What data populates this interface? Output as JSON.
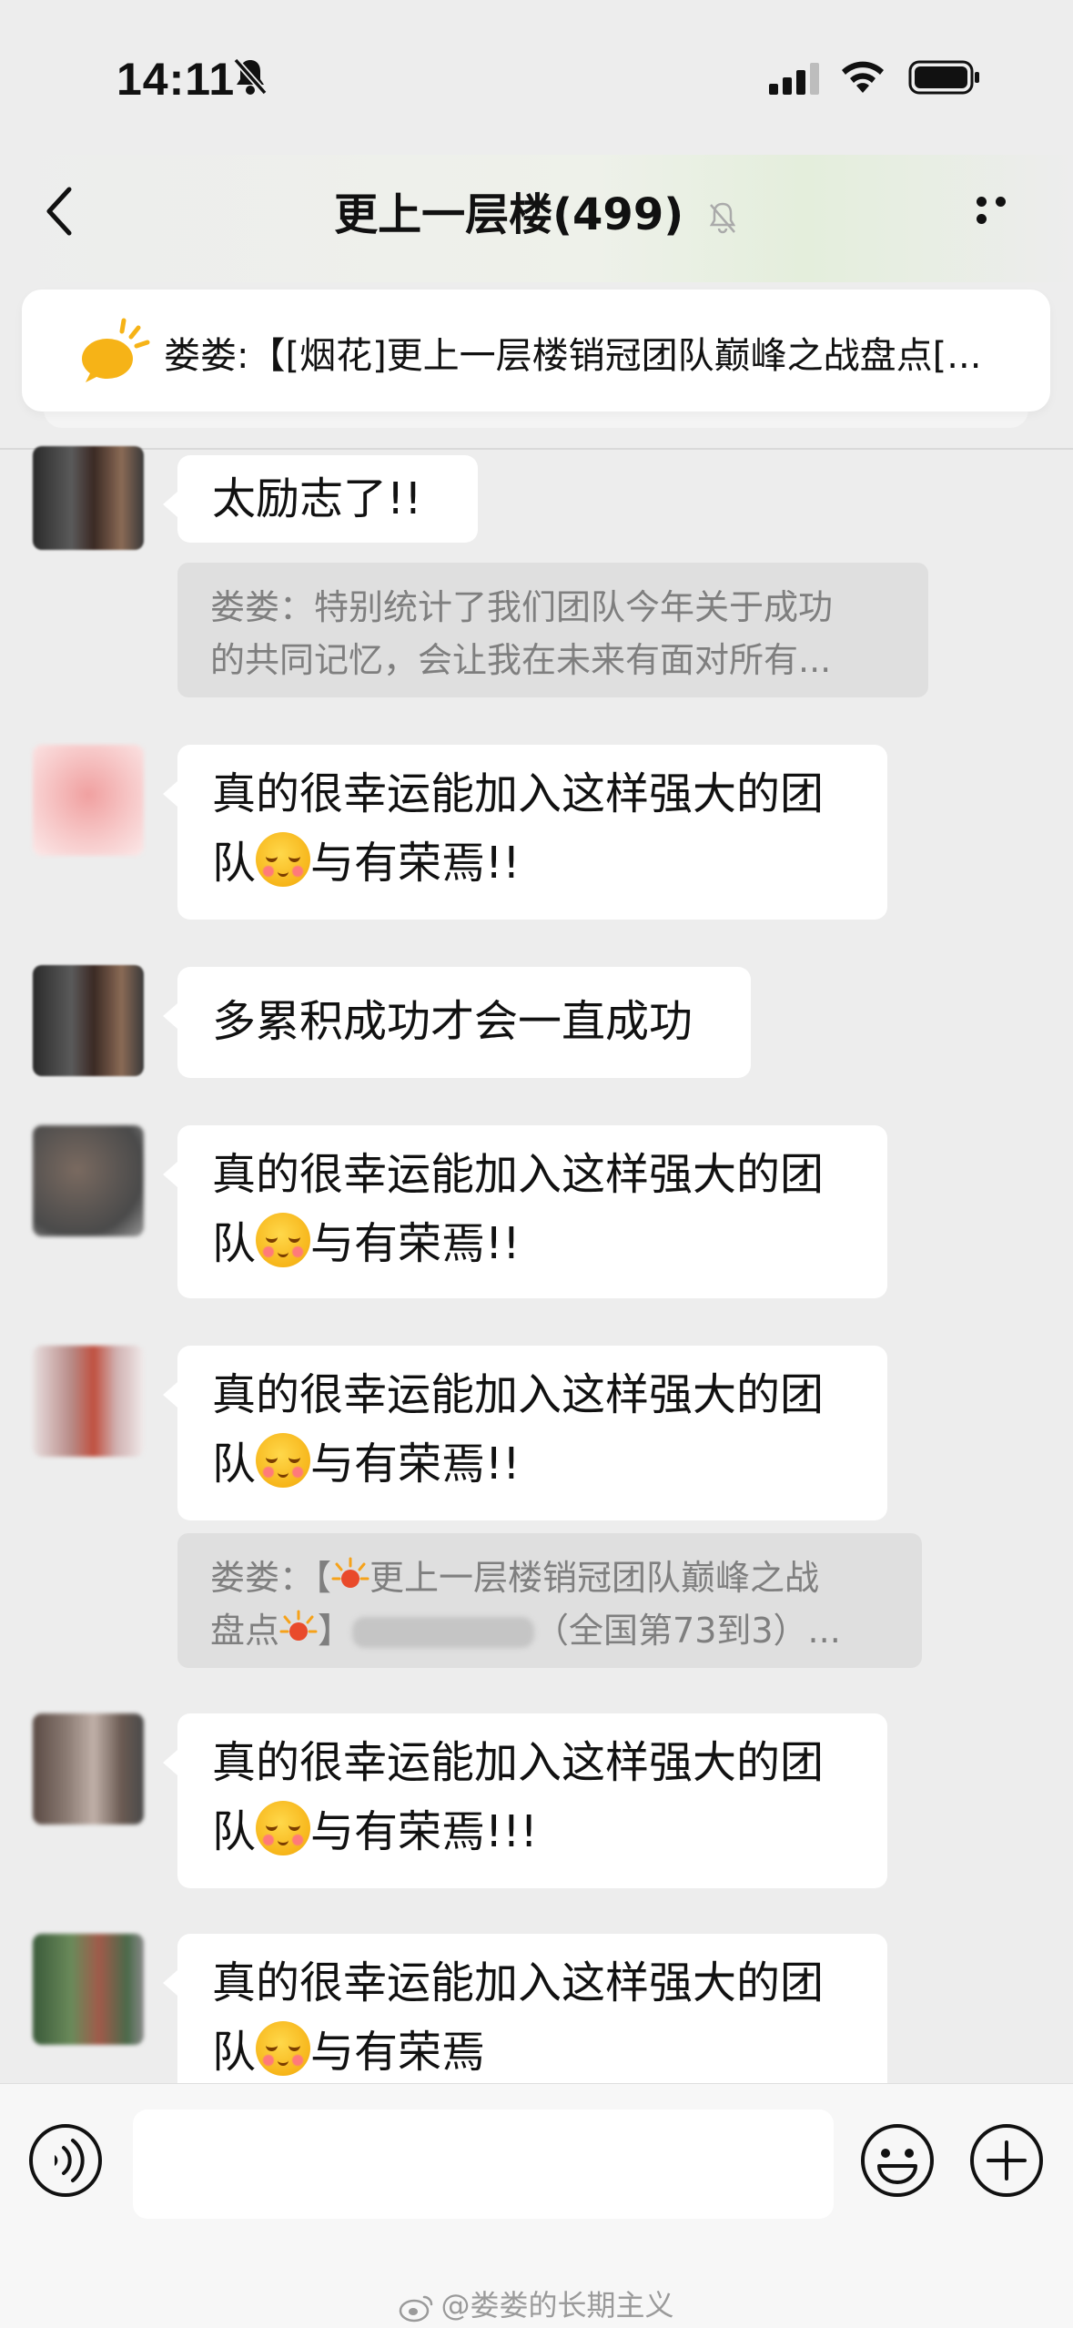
{
  "status": {
    "time": "14:11"
  },
  "nav": {
    "title": "更上一层楼(499)"
  },
  "pinned": {
    "text": "娄娄:【[烟花]更上一层楼销冠团队巅峰之战盘点[..."
  },
  "messages": [
    {
      "text": "太励志了!!"
    },
    {
      "text1": "真的很幸运能加入这样强大的团",
      "text2a": "队",
      "text2b": "与有荣焉!!"
    },
    {
      "text": "多累积成功才会一直成功"
    },
    {
      "text1": "真的很幸运能加入这样强大的团",
      "text2a": "队",
      "text2b": "与有荣焉!!"
    },
    {
      "text1": "真的很幸运能加入这样强大的团",
      "text2a": "队",
      "text2b": "与有荣焉!!"
    },
    {
      "text1": "真的很幸运能加入这样强大的团",
      "text2a": "队",
      "text2b": "与有荣焉!!!"
    },
    {
      "text1": "真的很幸运能加入这样强大的团",
      "text2a": "队",
      "text2b": "与有荣焉"
    }
  ],
  "quotes": [
    {
      "line1": "娄娄：特别统计了我们团队今年关于成功",
      "line2": "的共同记忆，会让我在未来有面对所有..."
    },
    {
      "line1a": "娄娄：【",
      "line1b": "更上一层楼销冠团队巅峰之战",
      "line2a": "盘点",
      "line2b": "】",
      "line2c": "（全国第73到3）..."
    }
  ],
  "watermark": "@娄娄的长期主义",
  "colors": {
    "background": "#ededed",
    "bubble": "#ffffff",
    "quote": "#dfdfdf",
    "pin_icon": "#f6b317"
  }
}
